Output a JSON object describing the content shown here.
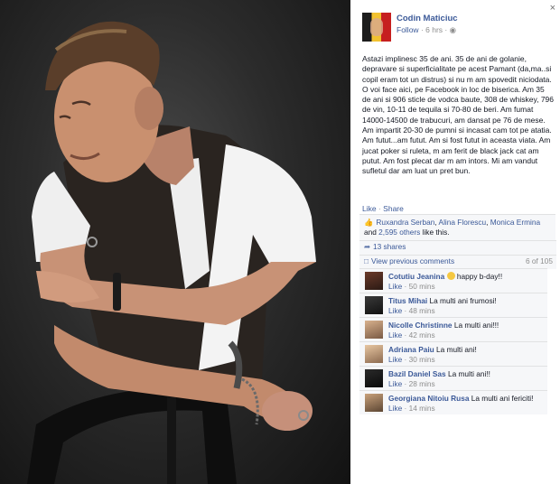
{
  "close_label": "×",
  "post": {
    "author": "Codin Maticiuc",
    "follow_label": "Follow",
    "time": "6 hrs",
    "text": "Astazi implinesc 35 de ani. 35 de ani de golanie, depravare si superficialitate pe acest Pamant (da,ma..si copil eram tot un distrus) si nu m am spovedit niciodata. O voi face aici, pe Facebook in loc de biserica. Am 35 de ani si 906 sticle de vodca baute, 308 de whiskey, 796 de vin, 10-11 de tequila si 70-80 de beri. Am fumat 14000-14500 de trabucuri, am dansat pe 76 de mese. Am impartit 20-30 de pumni si incasat cam tot pe atatia. Am futut...am futut. Am si fost futut in aceasta viata. Am jucat poker si ruleta, m am ferit de black jack cat am putut. Am fost plecat dar m am intors. Mi am vandut sufletul dar am luat un pret bun.",
    "like_action": "Like",
    "share_action": "Share"
  },
  "likes": {
    "names": [
      "Ruxandra Serban",
      "Alina Florescu",
      "Monica Ermina"
    ],
    "and_word": "and",
    "others": "2,595 others",
    "suffix": "like this."
  },
  "shares": "13 shares",
  "previous_comments": {
    "label": "View previous comments",
    "count": "6 of 105"
  },
  "comments": [
    {
      "name": "Cotutiu Jeanina",
      "text": "happy b-day!!",
      "like": "Like",
      "time": "50 mins",
      "emoji": "smile"
    },
    {
      "name": "Titus Mihai",
      "text": "La multi ani frumosi!",
      "like": "Like",
      "time": "48 mins"
    },
    {
      "name": "Nicolle Christinne",
      "text": "La multi ani!!!",
      "like": "Like",
      "time": "42 mins"
    },
    {
      "name": "Adriana Paiu",
      "text": "La multi ani!",
      "like": "Like",
      "time": "30 mins"
    },
    {
      "name": "Bazil Daniel Sas",
      "text": "La multi ani!!",
      "like": "Like",
      "time": "28 mins"
    },
    {
      "name": "Georgiana Nitoiu Rusa",
      "text": "La multi ani fericiti!",
      "like": "Like",
      "time": "14 mins"
    }
  ],
  "colors": {
    "link": "#3b5998",
    "ufi_bg": "#f6f7f9",
    "meta": "#8d8d8d"
  }
}
